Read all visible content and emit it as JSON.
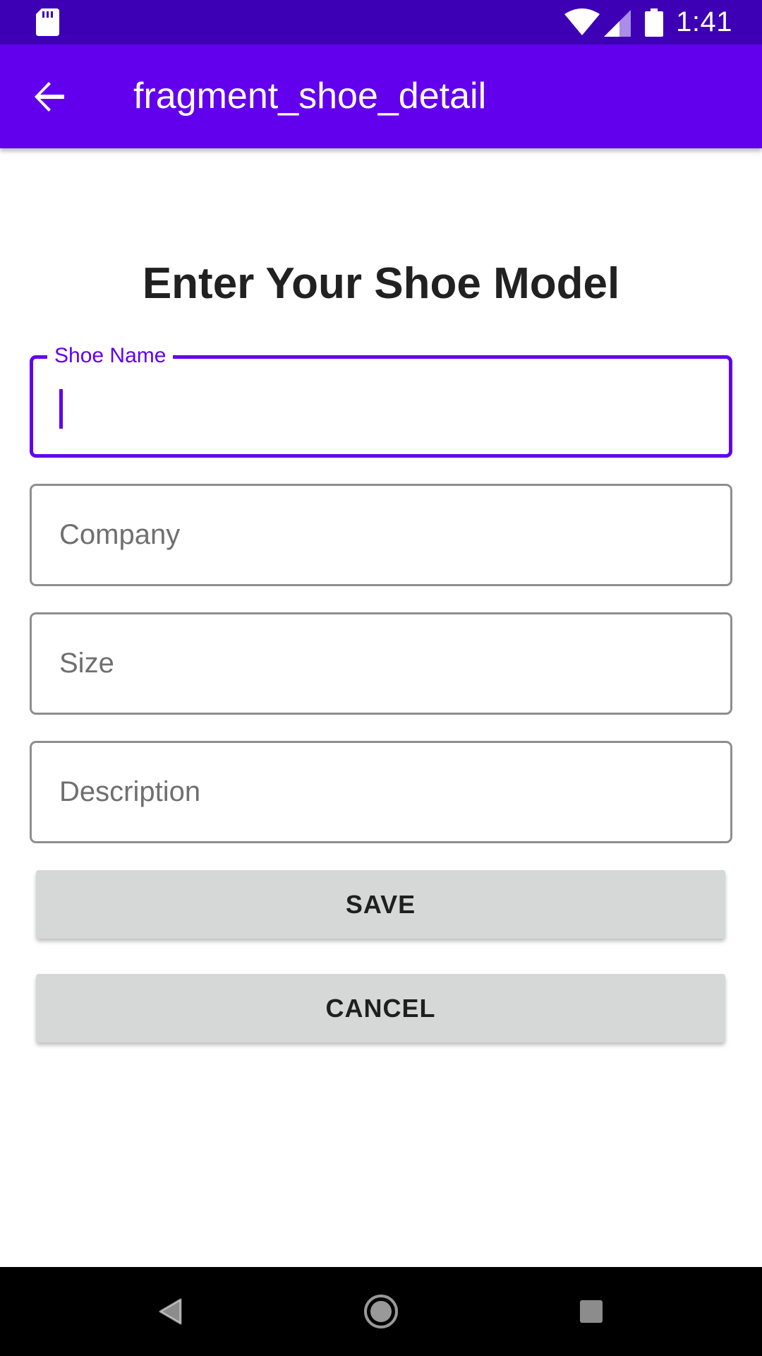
{
  "status_bar": {
    "time": "1:41",
    "icons": [
      "sd-card-icon",
      "wifi-icon",
      "signal-icon",
      "battery-icon"
    ]
  },
  "app_bar": {
    "title": "fragment_shoe_detail",
    "back_icon": "arrow-back-icon"
  },
  "form": {
    "heading": "Enter Your Shoe Model",
    "fields": [
      {
        "label": "Shoe Name",
        "value": "",
        "focused": true
      },
      {
        "placeholder": "Company",
        "value": ""
      },
      {
        "placeholder": "Size",
        "value": ""
      },
      {
        "placeholder": "Description",
        "value": ""
      }
    ],
    "save_label": "SAVE",
    "cancel_label": "CANCEL"
  },
  "nav_bar": {
    "icons": [
      "back-triangle-icon",
      "home-circle-icon",
      "recents-square-icon"
    ]
  },
  "colors": {
    "status_bar": "#3d00b5",
    "app_bar": "#6200ee",
    "accent": "#6200ee",
    "button": "#d6d7d7"
  }
}
